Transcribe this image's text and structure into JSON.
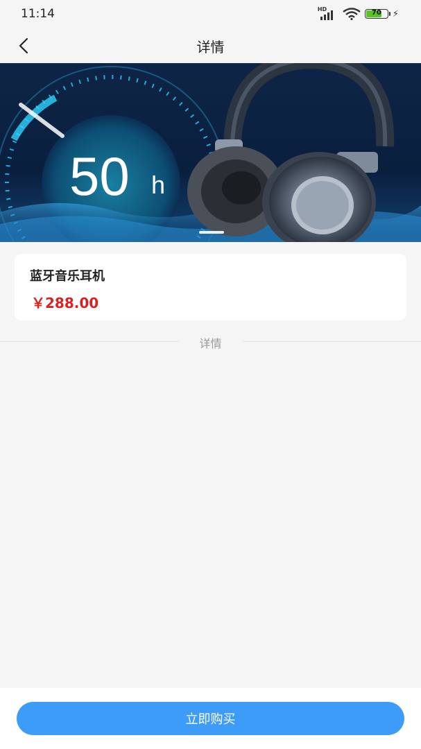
{
  "status_bar": {
    "time": "11:14",
    "network_label": "HD",
    "battery_level": "70"
  },
  "nav": {
    "back_icon": "chevron-left-icon",
    "title": "详情"
  },
  "banner": {
    "overlay_text": "50",
    "overlay_unit": "h",
    "slide_index": 1
  },
  "product": {
    "name": "蓝牙音乐耳机",
    "price": "￥288.00",
    "price_color": "#e02020"
  },
  "section": {
    "details_label": "详情"
  },
  "actions": {
    "buy_label": "立即购买",
    "buy_color": "#3d9cf7"
  }
}
